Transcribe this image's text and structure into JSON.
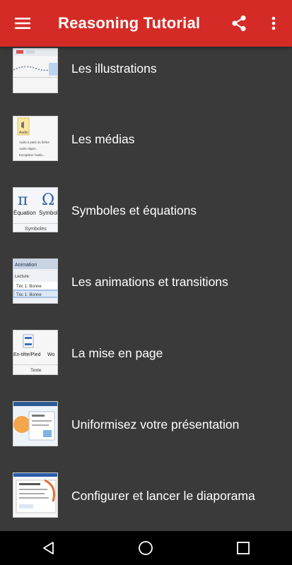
{
  "app_bar": {
    "title": "Reasoning Tutorial",
    "background": "#d52b27",
    "icons": [
      "hamburger-menu-icon",
      "share-icon",
      "more-vert-icon"
    ]
  },
  "list": {
    "items": [
      {
        "label": "Les illustrations",
        "thumbnail": "illustrations-thumbnail"
      },
      {
        "label": "Les médias",
        "thumbnail": "media-thumbnail"
      },
      {
        "label": "Symboles et équations",
        "thumbnail": "symbols-thumbnail"
      },
      {
        "label": "Les animations et transitions",
        "thumbnail": "animations-thumbnail"
      },
      {
        "label": "La mise en page",
        "thumbnail": "page-layout-thumbnail"
      },
      {
        "label": "Uniformisez votre présentation",
        "thumbnail": "uniformize-thumbnail"
      },
      {
        "label": "Configurer et lancer le diaporama",
        "thumbnail": "slideshow-thumbnail"
      }
    ]
  },
  "thumb_text": {
    "media_btn": "Audio",
    "media_line1": "Audio à partir du fichier",
    "media_line2": "Audio clipart...",
    "media_line3": "Enregistrer l'audio...",
    "sym_equation": "Équation",
    "sym_symbole": "Symbole",
    "sym_group": "Symboles",
    "anim_tab": "Animation",
    "anim_sub": "Lecture",
    "anim_item1": "Téc 1: Bonne",
    "anim_item2": "Téc 1: Bonne",
    "layout_btn": "En-tête/Pied",
    "layout_btn2": "Wo",
    "layout_group": "Texte"
  },
  "nav_bar": {
    "icons": [
      "back-icon",
      "home-icon",
      "recents-icon"
    ]
  },
  "colors": {
    "list_bg": "#3a3a3a",
    "nav_bg": "#000000",
    "text": "#ffffff"
  }
}
